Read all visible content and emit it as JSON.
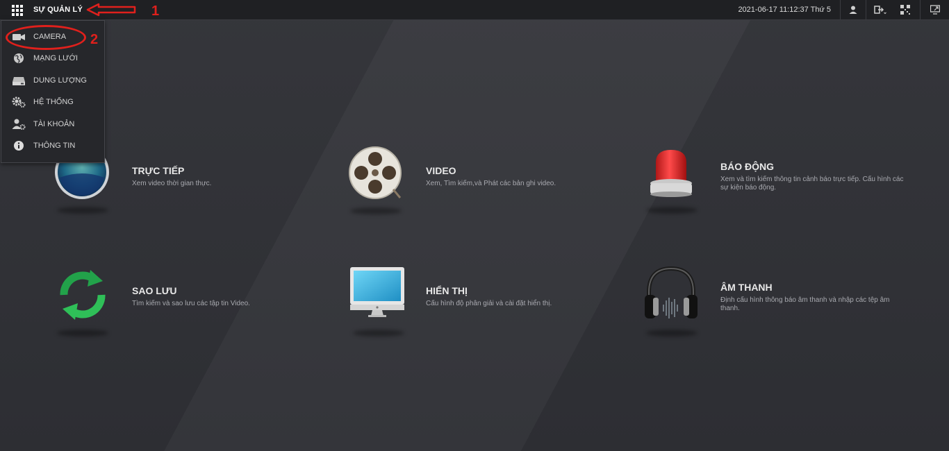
{
  "header": {
    "title": "SỰ QUẢN LÝ",
    "datetime": "2021-06-17 11:12:37 Thứ 5"
  },
  "annotations": {
    "one": "1",
    "two": "2"
  },
  "menu": {
    "items": [
      {
        "label": "CAMERA",
        "icon": "camera-icon"
      },
      {
        "label": "MẠNG LƯỚI",
        "icon": "network-icon"
      },
      {
        "label": "DUNG LƯỢNG",
        "icon": "storage-icon"
      },
      {
        "label": "HỆ THỐNG",
        "icon": "gear-icon"
      },
      {
        "label": "TÀI KHOẢN",
        "icon": "account-icon"
      },
      {
        "label": "THÔNG TIN",
        "icon": "info-icon"
      }
    ]
  },
  "tiles": {
    "live": {
      "title": "TRỰC TIẾP",
      "desc": "Xem video thời gian thực."
    },
    "video": {
      "title": "VIDEO",
      "desc": "Xem, Tìm kiếm,và Phát các bản ghi video."
    },
    "alarm": {
      "title": "BÁO ĐỘNG",
      "desc": "Xem và tìm kiếm thông tin cảnh báo trực tiếp. Cấu hình các sự kiện báo động."
    },
    "backup": {
      "title": "SAO LƯU",
      "desc": "Tìm kiếm và sao lưu các tập tin Video."
    },
    "display": {
      "title": "HIỂN THỊ",
      "desc": "Cấu hình độ phân giải và cài đặt hiển thị."
    },
    "audio": {
      "title": "ÂM THANH",
      "desc": "Định cấu hình thông báo âm thanh và nhập các tệp âm thanh."
    }
  },
  "colors": {
    "annotation": "#e0201c",
    "topbar": "#1f2023",
    "background": "#2f3035"
  }
}
